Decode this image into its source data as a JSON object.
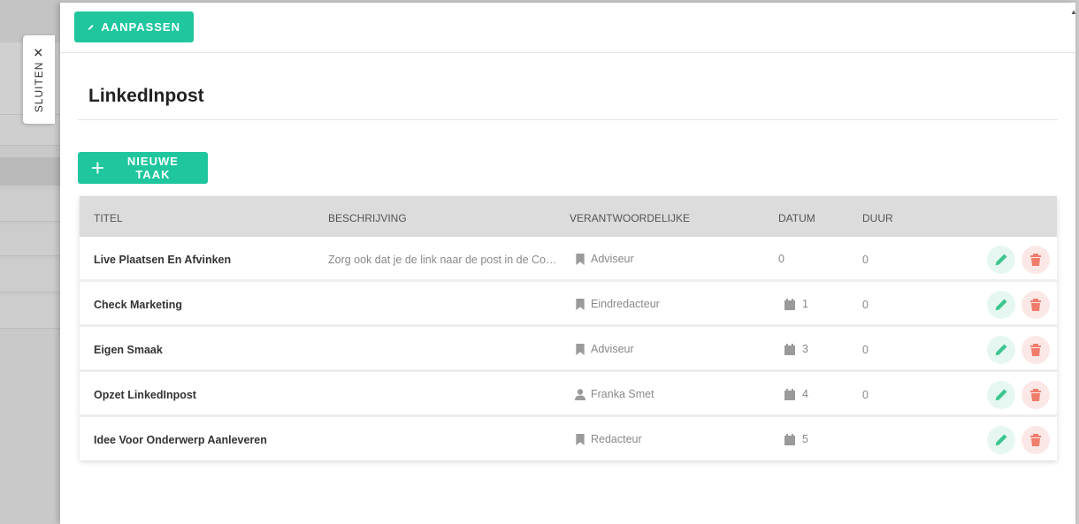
{
  "close_tab": {
    "label": "SLUITEN",
    "icon": "close-icon"
  },
  "toolbar": {
    "edit_label": "AANPASSEN"
  },
  "page": {
    "title": "LinkedInpost"
  },
  "actions": {
    "new_task_label": "NIEUWE TAAK"
  },
  "table": {
    "headers": [
      "TITEL",
      "BESCHRIJVING",
      "VERANTWOORDELIJKE",
      "DATUM",
      "DUUR"
    ],
    "rows": [
      {
        "title": "Live Plaatsen En Afvinken",
        "description": "Zorg ook dat je de link naar de post in de Con...",
        "responsible": "Adviseur",
        "responsible_icon": "bookmark-icon",
        "date": "0",
        "date_icon": "",
        "duration": "0"
      },
      {
        "title": "Check Marketing",
        "description": "",
        "responsible": "Eindredacteur",
        "responsible_icon": "bookmark-icon",
        "date": "1",
        "date_icon": "calendar-icon",
        "duration": "0"
      },
      {
        "title": "Eigen Smaak",
        "description": "",
        "responsible": "Adviseur",
        "responsible_icon": "bookmark-icon",
        "date": "3",
        "date_icon": "calendar-icon",
        "duration": "0"
      },
      {
        "title": "Opzet LinkedInpost",
        "description": "",
        "responsible": "Franka Smet",
        "responsible_icon": "user-icon",
        "date": "4",
        "date_icon": "calendar-icon",
        "duration": "0"
      },
      {
        "title": "Idee Voor Onderwerp Aanleveren",
        "description": "",
        "responsible": "Redacteur",
        "responsible_icon": "bookmark-icon",
        "date": "5",
        "date_icon": "calendar-icon",
        "duration": ""
      }
    ]
  },
  "colors": {
    "accent": "#1fc69e",
    "danger": "#f07c6c",
    "header_bg": "#dcdcdc"
  }
}
